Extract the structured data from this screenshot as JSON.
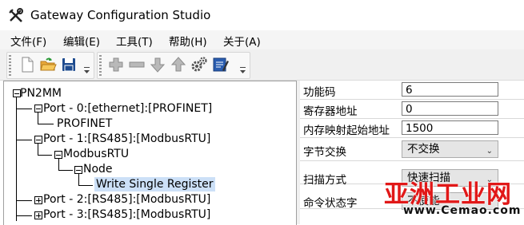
{
  "window": {
    "title": "Gateway Configuration Studio"
  },
  "menu": {
    "items": [
      {
        "label": "文件(F)"
      },
      {
        "label": "编辑(E)"
      },
      {
        "label": "工具(T)"
      },
      {
        "label": "帮助(H)"
      },
      {
        "label": "关于(A)"
      }
    ]
  },
  "toolbar": {
    "file_group": [
      "new-file-icon",
      "open-folder-icon",
      "save-icon"
    ],
    "edit_group": [
      "add-icon",
      "remove-icon",
      "move-down-icon",
      "move-up-icon",
      "settings-gear-icon",
      "edit-note-icon"
    ]
  },
  "tree": {
    "nodes": [
      {
        "label": "PN2MM"
      },
      {
        "label": "Port - 0:[ethernet]:[PROFINET]"
      },
      {
        "label": "PROFINET"
      },
      {
        "label": "Port - 1:[RS485]:[ModbusRTU]"
      },
      {
        "label": "ModbusRTU"
      },
      {
        "label": "Node"
      },
      {
        "label": "Write Single Register",
        "selected": true
      },
      {
        "label": "Port - 2:[RS485]:[ModbusRTU]"
      },
      {
        "label": "Port - 3:[RS485]:[ModbusRTU]"
      }
    ]
  },
  "properties": {
    "rows": [
      {
        "name": "功能码",
        "value": "6"
      },
      {
        "name": "寄存器地址",
        "value": "0"
      },
      {
        "name": "内存映射起始地址",
        "value": "1500"
      },
      {
        "name": "字节交换",
        "value": "不交换"
      },
      {
        "name": "扫描方式",
        "value": "快速扫描"
      },
      {
        "name": "命令状态字",
        "value": "不使能"
      }
    ]
  },
  "watermark": {
    "main": "亚洲工业网",
    "sub": "www.Cemao.com"
  },
  "colors": {
    "selection": "#cce0f7",
    "watermark_red": "#e11818",
    "save_blue": "#1e4b8f"
  }
}
